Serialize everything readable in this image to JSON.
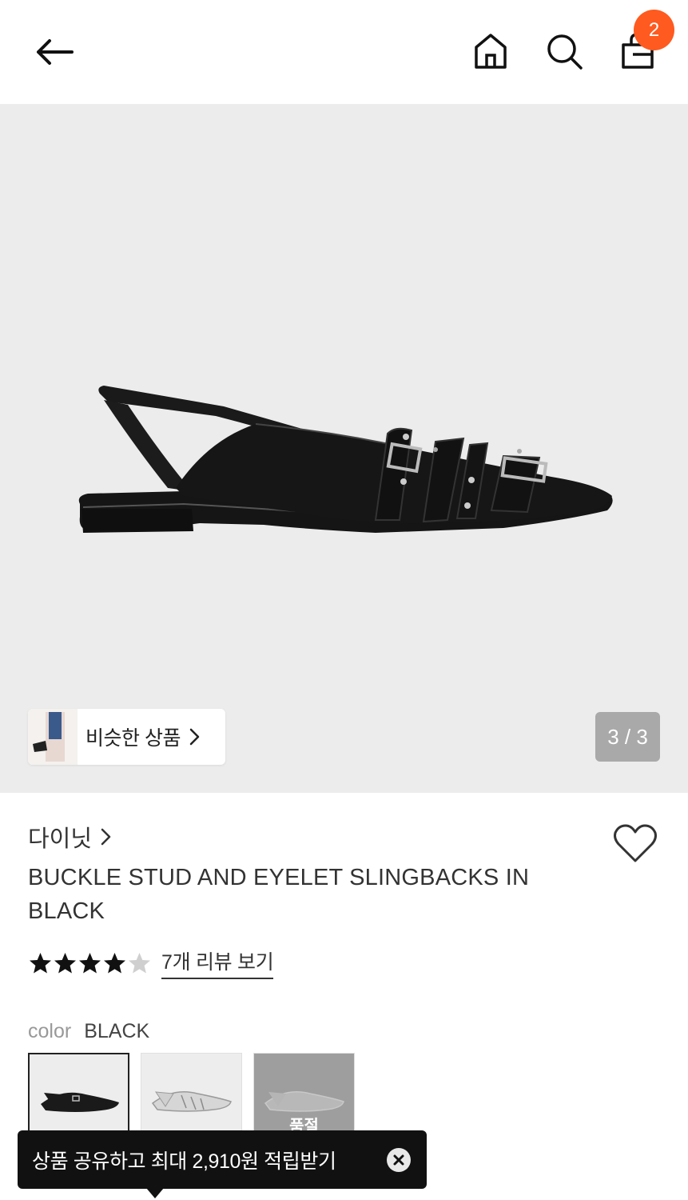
{
  "header": {
    "back_icon": "arrow-left-icon",
    "home_icon": "home-icon",
    "search_icon": "search-icon",
    "cart_icon": "shopping-bag-icon",
    "cart_count": "2",
    "badge_color": "#ff5a1f"
  },
  "gallery": {
    "similar_label": "비슷한 상품",
    "page_counter": "3 / 3",
    "background": "#ececec"
  },
  "product": {
    "brand": "다이닛",
    "title": "BUCKLE STUD AND EYELET SLINGBACKS IN BLACK",
    "rating": 4,
    "rating_max": 5,
    "review_link": "7개 리뷰 보기",
    "color_label": "color",
    "color_value": "BLACK",
    "swatches": [
      {
        "color": "black",
        "selected": true
      },
      {
        "color": "silver",
        "selected": false
      },
      {
        "color": "white",
        "selected": false,
        "soldout_label": "품절"
      }
    ]
  },
  "toast": {
    "message": "상품 공유하고 최대 2,910원 적립받기",
    "close_icon": "close-icon"
  }
}
